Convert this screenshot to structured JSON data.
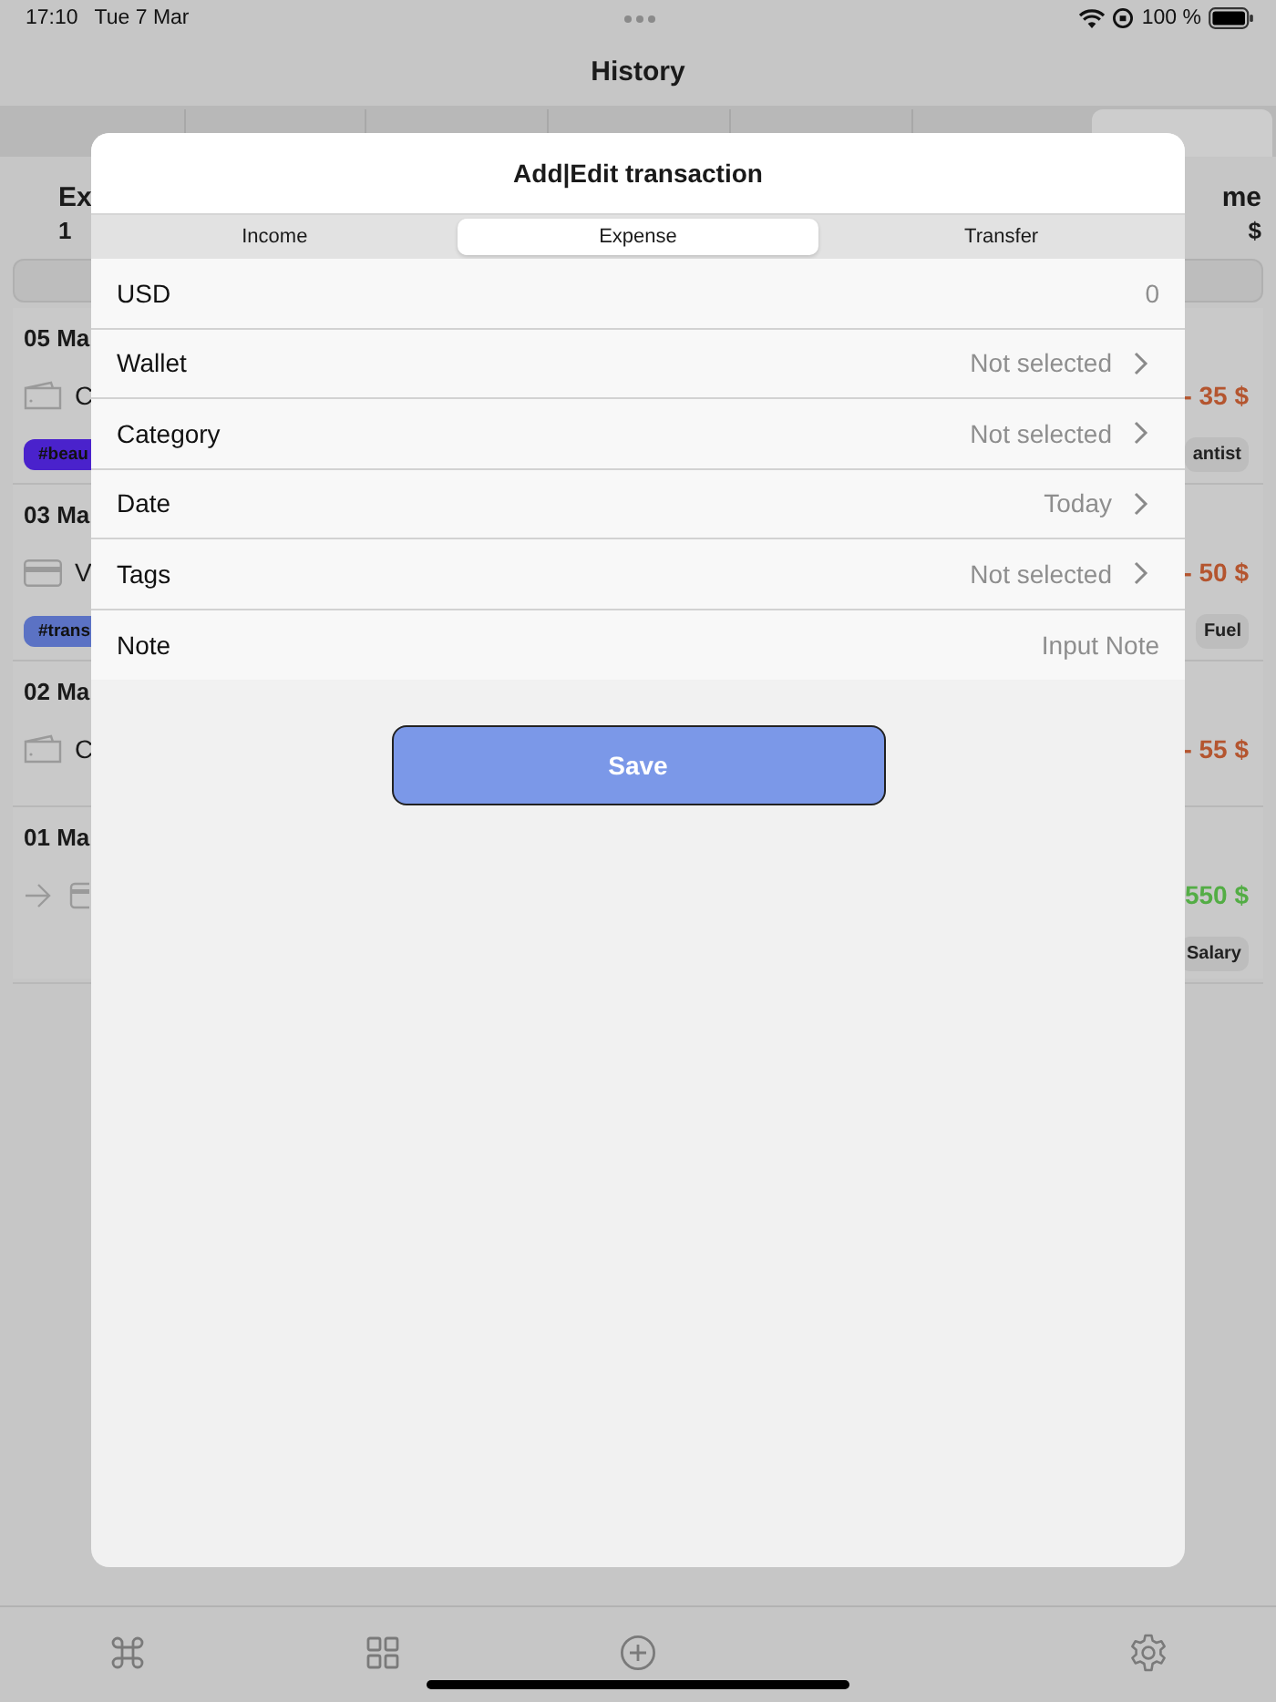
{
  "status_bar": {
    "time": "17:10",
    "date": "Tue 7 Mar",
    "battery": "100 %"
  },
  "header": {
    "title": "History"
  },
  "months": [
    {
      "selected": false
    },
    {
      "selected": false
    },
    {
      "selected": false
    },
    {
      "selected": false
    },
    {
      "selected": false
    },
    {
      "selected": false
    },
    {
      "selected": true
    }
  ],
  "summary": {
    "left_label": "Ex",
    "left_value": "1",
    "right_label": "me",
    "right_value": "$"
  },
  "days": [
    {
      "date": "05 Ma",
      "entries": [
        {
          "kind": "cash",
          "text": "C",
          "amount": "- 35 $",
          "tag": {
            "label": "#beau",
            "color": "#4a22cc"
          },
          "chip": "antist"
        }
      ]
    },
    {
      "date": "03 Ma",
      "entries": [
        {
          "kind": "card",
          "text": "V",
          "amount": "- 50 $",
          "tag": {
            "label": "#trans",
            "color": "#5b72c4"
          },
          "chip": "Fuel"
        }
      ]
    },
    {
      "date": "02 Ma",
      "entries": [
        {
          "kind": "cash",
          "text": "C",
          "amount": "- 55 $"
        }
      ]
    },
    {
      "date": "01 Ma",
      "entries": [
        {
          "kind": "transfer",
          "amount": "550 $",
          "chip": "Salary"
        }
      ]
    }
  ],
  "dialog": {
    "title": "Add|Edit transaction",
    "segments": [
      {
        "label": "Income",
        "selected": false
      },
      {
        "label": "Expense",
        "selected": true
      },
      {
        "label": "Transfer",
        "selected": false
      }
    ],
    "fields": [
      {
        "kind": "amount",
        "label": "USD",
        "value": "0"
      },
      {
        "kind": "picker",
        "label": "Wallet",
        "value": "Not selected"
      },
      {
        "kind": "picker",
        "label": "Category",
        "value": "Not selected"
      },
      {
        "kind": "picker",
        "label": "Date",
        "value": "Today"
      },
      {
        "kind": "picker",
        "label": "Tags",
        "value": "Not selected"
      },
      {
        "kind": "input",
        "label": "Note",
        "placeholder": "Input Note"
      }
    ],
    "save": "Save"
  }
}
